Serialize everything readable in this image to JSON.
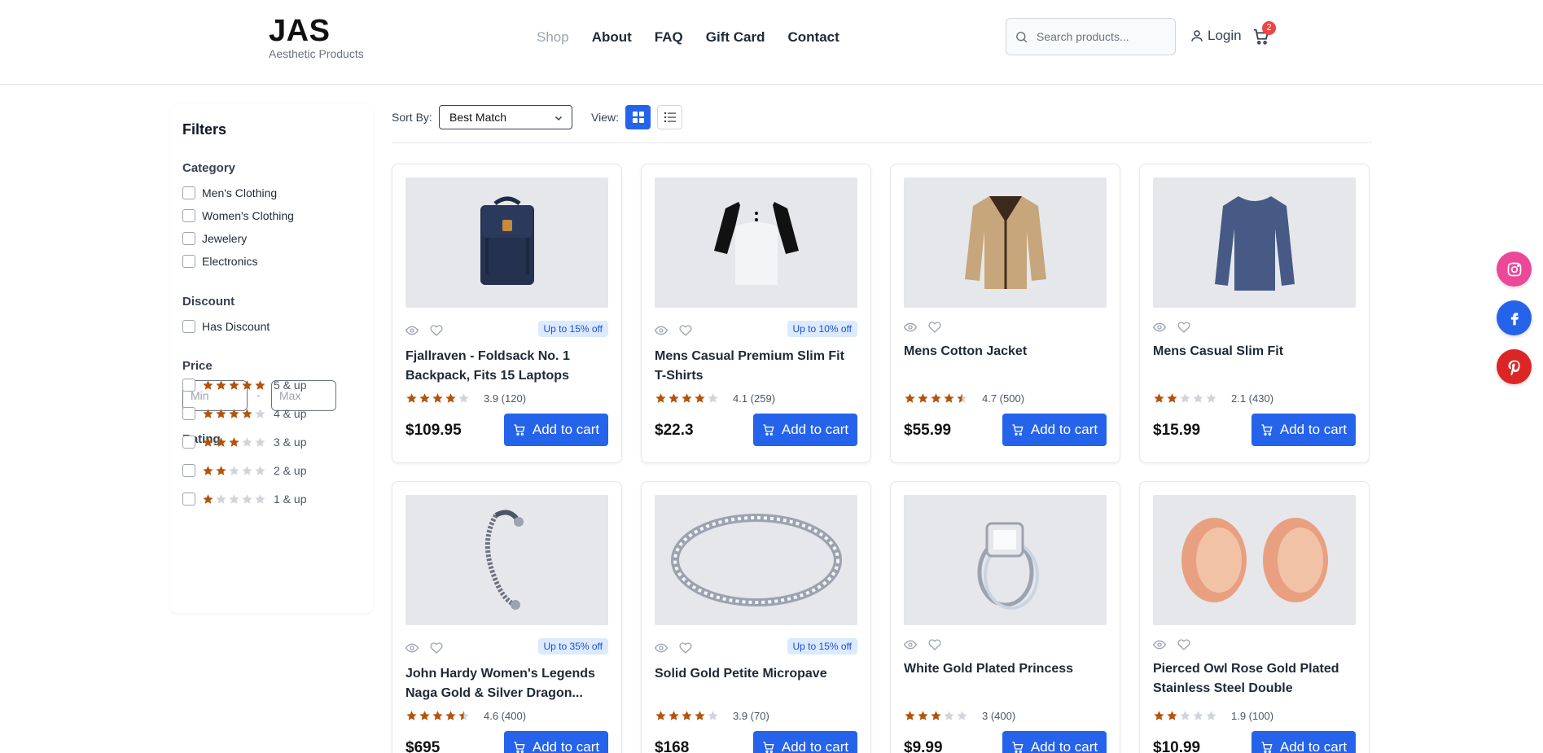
{
  "brand": {
    "title": "JAS",
    "subtitle": "Aesthetic Products"
  },
  "nav": [
    {
      "label": "Shop",
      "active": false
    },
    {
      "label": "About"
    },
    {
      "label": "FAQ"
    },
    {
      "label": "Gift Card"
    },
    {
      "label": "Contact"
    }
  ],
  "header": {
    "search_placeholder": "Search products...",
    "login_label": "Login",
    "cart_count": "2"
  },
  "filters": {
    "title": "Filters",
    "category_heading": "Category",
    "categories": [
      "Men's Clothing",
      "Women's Clothing",
      "Jewelery",
      "Electronics"
    ],
    "discount_heading": "Discount",
    "discount_option": "Has Discount",
    "price_heading": "Price",
    "price_min_placeholder": "Min",
    "price_max_placeholder": "Max",
    "price_separator": "-",
    "rating_heading": "Rating",
    "ratings": [
      {
        "label": "5 & up",
        "stars": 5
      },
      {
        "label": "4 & up",
        "stars": 4
      },
      {
        "label": "3 & up",
        "stars": 3
      },
      {
        "label": "2 & up",
        "stars": 2
      },
      {
        "label": "1 & up",
        "stars": 1
      }
    ]
  },
  "toolbar": {
    "sort_label": "Sort By:",
    "sort_value": "Best Match",
    "view_label": "View:",
    "view_mode": "grid"
  },
  "products": [
    {
      "title": "Fjallraven - Foldsack No. 1 Backpack, Fits 15 Laptops",
      "discount": "Up to 15% off",
      "rating": 3.9,
      "rating_text": "3.9 (120)",
      "price": "$109.95",
      "image": "backpack"
    },
    {
      "title": "Mens Casual Premium Slim Fit T-Shirts",
      "discount": "Up to 10% off",
      "rating": 4.1,
      "rating_text": "4.1 (259)",
      "price": "$22.3",
      "image": "raglan-shirt"
    },
    {
      "title": "Mens Cotton Jacket",
      "discount": "",
      "rating": 4.7,
      "rating_text": "4.7 (500)",
      "price": "$55.99",
      "image": "jacket"
    },
    {
      "title": "Mens Casual Slim Fit",
      "discount": "",
      "rating": 2.1,
      "rating_text": "2.1 (430)",
      "price": "$15.99",
      "image": "long-sleeve-shirt"
    },
    {
      "title": "John Hardy Women's Legends Naga Gold & Silver Dragon...",
      "discount": "Up to 35% off",
      "rating": 4.6,
      "rating_text": "4.6 (400)",
      "price": "$695",
      "image": "bracelet"
    },
    {
      "title": "Solid Gold Petite Micropave",
      "discount": "Up to 15% off",
      "rating": 3.9,
      "rating_text": "3.9 (70)",
      "price": "$168",
      "image": "ring-band"
    },
    {
      "title": "White Gold Plated Princess",
      "discount": "",
      "rating": 3,
      "rating_text": "3 (400)",
      "price": "$9.99",
      "image": "diamond-ring"
    },
    {
      "title": "Pierced Owl Rose Gold Plated Stainless Steel Double",
      "discount": "",
      "rating": 1.9,
      "rating_text": "1.9 (100)",
      "price": "$10.99",
      "image": "ear-tunnels"
    }
  ],
  "add_to_cart_label": "Add to cart",
  "social": [
    {
      "name": "instagram-icon",
      "color": "#ec4899"
    },
    {
      "name": "facebook-icon",
      "color": "#2563eb"
    },
    {
      "name": "pinterest-icon",
      "color": "#dc2626"
    }
  ],
  "colors": {
    "accent": "#2563eb",
    "star": "#b45309",
    "star_empty": "#d1d5db",
    "badge": "#ef4444"
  }
}
